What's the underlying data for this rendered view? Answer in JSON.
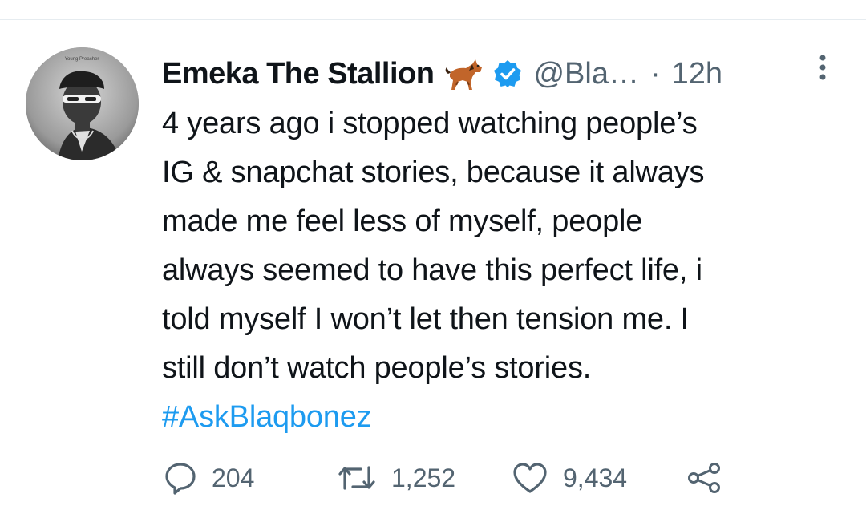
{
  "tweet": {
    "author_name": "Emeka The Stallion",
    "handle": "@Bla…",
    "separator": "·",
    "time": "12h",
    "emoji": "horse-emoji",
    "verified_icon": "verified-badge-icon",
    "avatar_caption": "Young Preacher",
    "text": "4 years ago i stopped watching people’s\nIG & snapchat stories, because it always\nmade me feel less of myself, people\nalways seemed to have this perfect life, i\ntold myself I won’t let then tension me. I\nstill don’t watch people’s stories.",
    "hashtag": "#AskBlaqbonez"
  },
  "actions": {
    "replies": "204",
    "retweets": "1,252",
    "likes": "9,434"
  },
  "colors": {
    "text": "#0f1419",
    "secondary": "#536471",
    "link": "#1d9bf0",
    "verified": "#1d9bf0"
  }
}
